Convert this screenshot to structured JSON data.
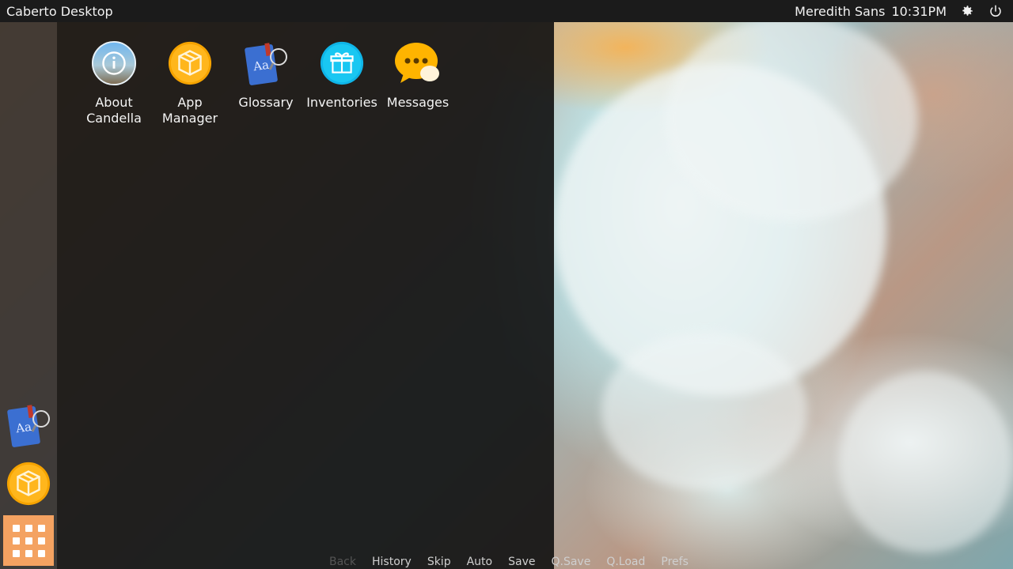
{
  "topbar": {
    "title": "Caberto Desktop",
    "user": "Meredith Sans",
    "time": "10:31PM",
    "settings_icon": "gear-icon",
    "power_icon": "power-icon"
  },
  "apps": [
    {
      "label": "About Candella",
      "icon": "info-icon"
    },
    {
      "label": "App Manager",
      "icon": "package-icon"
    },
    {
      "label": "Glossary",
      "icon": "dictionary-icon"
    },
    {
      "label": "Inventories",
      "icon": "gift-icon"
    },
    {
      "label": "Messages",
      "icon": "chat-bubbles-icon"
    }
  ],
  "dock": {
    "items": [
      "dictionary-icon",
      "package-icon"
    ],
    "launcher_icon": "grid-icon",
    "launcher_color": "#f4a261"
  },
  "quick_menu": [
    "Back",
    "History",
    "Skip",
    "Auto",
    "Save",
    "Q.Save",
    "Q.Load",
    "Prefs"
  ],
  "colors": {
    "topbar_bg": "#1b1b1b",
    "accent": "#f4a261"
  }
}
